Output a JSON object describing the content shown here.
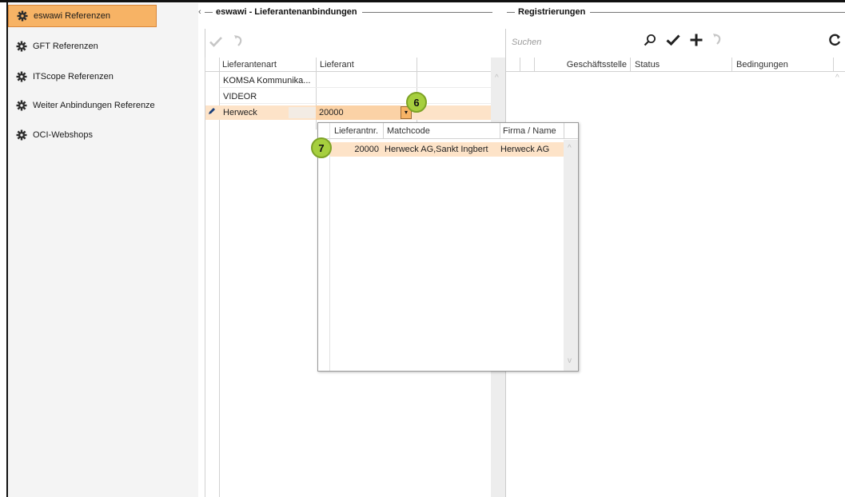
{
  "sidebar": {
    "items": [
      {
        "label": "eswawi Referenzen",
        "active": true
      },
      {
        "label": "GFT Referenzen",
        "active": false
      },
      {
        "label": "ITScope Referenzen",
        "active": false
      },
      {
        "label": "Weiter Anbindungen Referenze",
        "active": false
      },
      {
        "label": "OCI-Webshops",
        "active": false
      }
    ]
  },
  "left_group": {
    "title": "eswawi - Lieferantenanbindungen",
    "columns": [
      "Lieferantenart",
      "Lieferant"
    ],
    "rows": [
      {
        "lieferantenart": "KOMSA Kommunika...",
        "lieferant": ""
      },
      {
        "lieferantenart": "VIDEOR",
        "lieferant": ""
      },
      {
        "lieferantenart": "Herweck",
        "lieferant": "20000",
        "editing": true
      }
    ]
  },
  "right_group": {
    "title": "Registrierungen",
    "search_placeholder": "Suchen",
    "columns": [
      "Geschäftsstelle",
      "Status",
      "Bedingungen"
    ]
  },
  "dropdown": {
    "columns": [
      "Lieferantnr.",
      "Matchcode",
      "Firma / Name"
    ],
    "rows": [
      {
        "lieferantnr": "20000",
        "matchcode": "Herweck AG,Sankt Ingbert",
        "firma": "Herweck AG"
      }
    ]
  },
  "callouts": {
    "six": "6",
    "seven": "7"
  },
  "colors": {
    "accent": "#f7b365",
    "selected_row": "#fde3c8",
    "badge": "#a6cf3e"
  }
}
